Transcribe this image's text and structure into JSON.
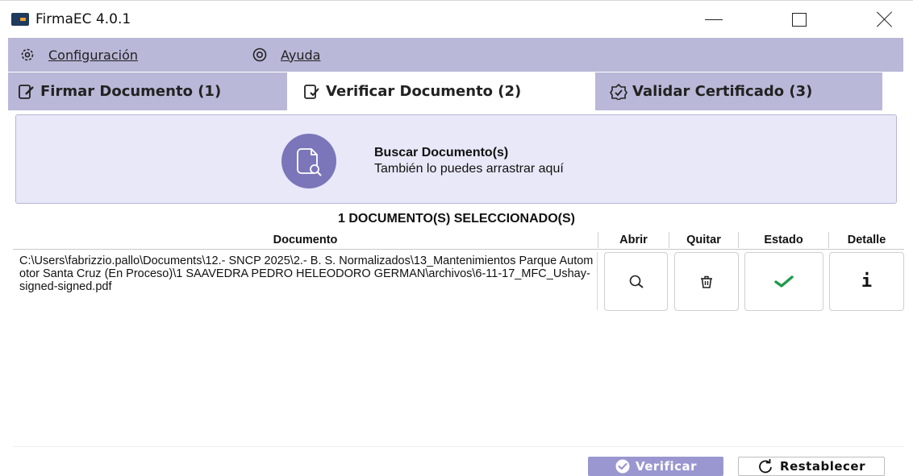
{
  "window": {
    "title": "FirmaEC 4.0.1"
  },
  "menu": {
    "configuration": "Configuración",
    "help": "Ayuda"
  },
  "tabs": [
    {
      "label": "Firmar Documento (1)",
      "active": false
    },
    {
      "label": "Verificar Documento (2)",
      "active": true
    },
    {
      "label": "Validar Certificado (3)",
      "active": false
    }
  ],
  "dropzone": {
    "title": "Buscar Documento(s)",
    "subtitle": "También lo puedes arrastrar aquí"
  },
  "selection": {
    "count_label": "1 DOCUMENTO(S) SELECCIONADO(S)"
  },
  "table": {
    "columns": {
      "document": "Documento",
      "open": "Abrir",
      "remove": "Quitar",
      "status": "Estado",
      "detail": "Detalle"
    },
    "rows": [
      {
        "path": "C:\\Users\\fabrizzio.pallo\\Documents\\12.- SNCP 2025\\2.- B. S. Normalizados\\13_Mantenimientos Parque Automotor Santa Cruz (En Proceso)\\1 SAAVEDRA PEDRO HELEODORO GERMAN\\archivos\\6-11-17_MFC_Ushay-signed-signed.pdf",
        "status_icon": "checkmark-icon"
      }
    ]
  },
  "actions": {
    "verify": "Verificar",
    "reset": "Restablecer"
  },
  "colors": {
    "accent": "#b9b8d8",
    "icon_circle": "#7b76ba",
    "dropzone_bg": "#e8e8f8",
    "verify_button": "#9a97d0",
    "status_ok": "#1e9a4a"
  }
}
